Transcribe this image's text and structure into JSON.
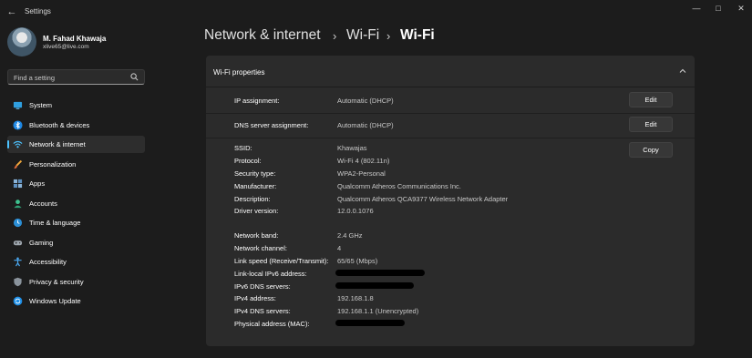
{
  "window": {
    "title": "Settings"
  },
  "user": {
    "name": "M. Fahad Khawaja",
    "email": "xlive65@live.com"
  },
  "search": {
    "placeholder": "Find a setting"
  },
  "accent": "#4cc2ff",
  "sidebar": {
    "items": [
      {
        "label": "System",
        "icon": "monitor-icon"
      },
      {
        "label": "Bluetooth & devices",
        "icon": "bluetooth-icon"
      },
      {
        "label": "Network & internet",
        "icon": "wifi-icon",
        "active": true
      },
      {
        "label": "Personalization",
        "icon": "brush-icon"
      },
      {
        "label": "Apps",
        "icon": "apps-icon"
      },
      {
        "label": "Accounts",
        "icon": "person-icon"
      },
      {
        "label": "Time & language",
        "icon": "globe-clock-icon"
      },
      {
        "label": "Gaming",
        "icon": "gamepad-icon"
      },
      {
        "label": "Accessibility",
        "icon": "accessibility-icon"
      },
      {
        "label": "Privacy & security",
        "icon": "shield-icon"
      },
      {
        "label": "Windows Update",
        "icon": "update-icon"
      }
    ]
  },
  "breadcrumb": {
    "level1": "Network & internet",
    "level2": "Wi-Fi",
    "current": "Wi-Fi",
    "separator": "›"
  },
  "panel": {
    "title": "Wi-Fi properties",
    "ip_assignment": {
      "label": "IP assignment:",
      "value": "Automatic (DHCP)",
      "button": "Edit"
    },
    "dns_assignment": {
      "label": "DNS server assignment:",
      "value": "Automatic (DHCP)",
      "button": "Edit"
    },
    "copy_button": "Copy",
    "details": [
      {
        "label": "SSID:",
        "value": "Khawajas"
      },
      {
        "label": "Protocol:",
        "value": "Wi-Fi 4 (802.11n)"
      },
      {
        "label": "Security type:",
        "value": "WPA2-Personal"
      },
      {
        "label": "Manufacturer:",
        "value": "Qualcomm Atheros Communications Inc."
      },
      {
        "label": "Description:",
        "value": "Qualcomm Atheros QCA9377 Wireless Network Adapter"
      },
      {
        "label": "Driver version:",
        "value": "12.0.0.1076"
      }
    ],
    "network": [
      {
        "label": "Network band:",
        "value": "2.4 GHz"
      },
      {
        "label": "Network channel:",
        "value": "4"
      },
      {
        "label": "Link speed (Receive/Transmit):",
        "value": "65/65 (Mbps)"
      },
      {
        "label": "Link-local IPv6 address:",
        "value": "",
        "redacted": true
      },
      {
        "label": "IPv6 DNS servers:",
        "value": "",
        "redacted": true
      },
      {
        "label": "IPv4 address:",
        "value": "192.168.1.8"
      },
      {
        "label": "IPv4 DNS servers:",
        "value": "192.168.1.1 (Unencrypted)"
      },
      {
        "label": "Physical address (MAC):",
        "value": "",
        "redacted": true
      }
    ]
  }
}
